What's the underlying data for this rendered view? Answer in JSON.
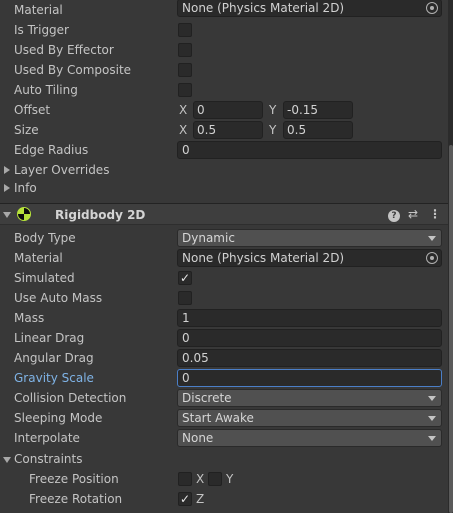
{
  "collider": {
    "material_label": "Material",
    "material_value": "None (Physics Material 2D)",
    "is_trigger_label": "Is Trigger",
    "used_by_effector_label": "Used By Effector",
    "used_by_composite_label": "Used By Composite",
    "auto_tiling_label": "Auto Tiling",
    "offset_label": "Offset",
    "offset_x": "0",
    "offset_y": "-0.15",
    "size_label": "Size",
    "size_x": "0.5",
    "size_y": "0.5",
    "edge_radius_label": "Edge Radius",
    "edge_radius_value": "0",
    "layer_overrides_label": "Layer Overrides",
    "info_label": "Info",
    "axis_x": "X",
    "axis_y": "Y"
  },
  "rigidbody": {
    "title": "Rigidbody 2D",
    "help_glyph": "?",
    "presets_glyph": "⇄",
    "menu_glyph": "⋮",
    "body_type_label": "Body Type",
    "body_type_value": "Dynamic",
    "material_label": "Material",
    "material_value": "None (Physics Material 2D)",
    "simulated_label": "Simulated",
    "simulated_checked": true,
    "use_auto_mass_label": "Use Auto Mass",
    "use_auto_mass_checked": false,
    "mass_label": "Mass",
    "mass_value": "1",
    "linear_drag_label": "Linear Drag",
    "linear_drag_value": "0",
    "angular_drag_label": "Angular Drag",
    "angular_drag_value": "0.05",
    "gravity_scale_label": "Gravity Scale",
    "gravity_scale_value": "0",
    "collision_detection_label": "Collision Detection",
    "collision_detection_value": "Discrete",
    "sleeping_mode_label": "Sleeping Mode",
    "sleeping_mode_value": "Start Awake",
    "interpolate_label": "Interpolate",
    "interpolate_value": "None",
    "constraints_label": "Constraints",
    "freeze_position_label": "Freeze Position",
    "freeze_rotation_label": "Freeze Rotation",
    "axis_x": "X",
    "axis_y": "Y",
    "axis_z": "Z",
    "check_glyph": "✓"
  },
  "colors": {
    "background": "#383838",
    "field": "#2a2a2a",
    "focus_border": "#4b7fc8",
    "highlight_label": "#7fb3e6",
    "rigidbody_icon": "#b6e23a"
  },
  "icons": [
    "object-picker-icon",
    "rigidbody2d-icon",
    "help-icon",
    "presets-icon",
    "kebab-menu-icon",
    "foldout-arrow-icon",
    "dropdown-arrow-icon",
    "checkmark-icon"
  ]
}
